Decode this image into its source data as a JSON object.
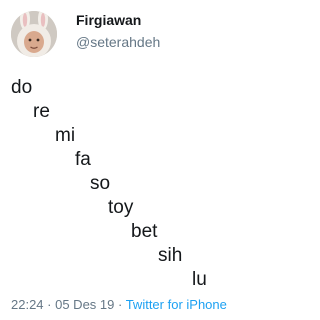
{
  "author": {
    "display_name": "Firgiawan",
    "handle": "@seterahdeh",
    "avatar_icon": "bunny-hood-avatar"
  },
  "tweet": {
    "lines": [
      "do",
      "re",
      "mi",
      "fa",
      "so",
      "toy",
      "bet",
      "sih",
      "lu"
    ]
  },
  "meta": {
    "time": "22:24",
    "separator": " · ",
    "date": "05 Des 19",
    "source": "Twitter for iPhone"
  },
  "colors": {
    "text": "#14171a",
    "secondary": "#657786",
    "link": "#1da1f2"
  }
}
